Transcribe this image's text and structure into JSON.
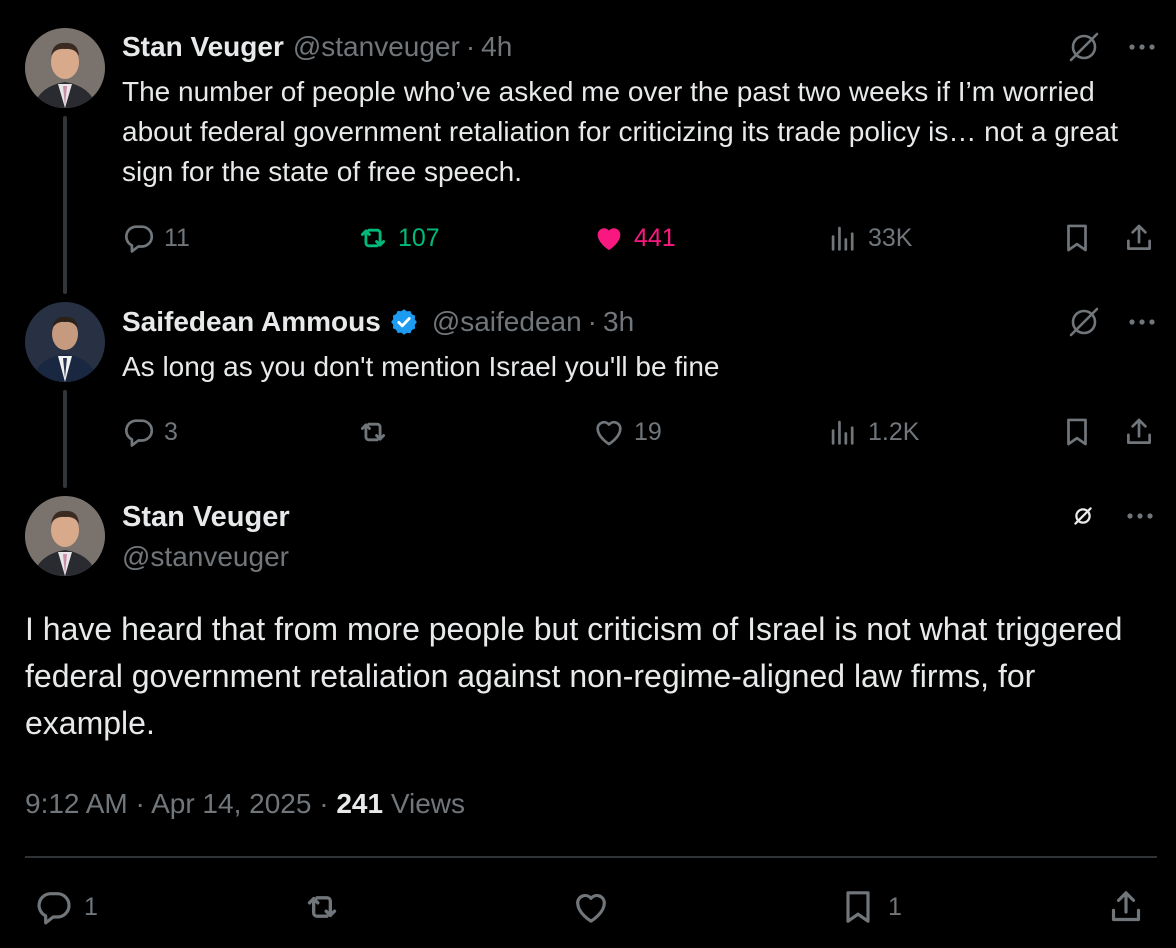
{
  "tweets": [
    {
      "name": "Stan Veuger",
      "handle": "@stanveuger",
      "separator": "·",
      "time": "4h",
      "text": "The number of people who’ve asked me over the past two weeks if I’m worried about federal government retaliation for criticizing its trade policy is… not a great sign for the state of free speech.",
      "replies": "11",
      "reposts": "107",
      "likes": "441",
      "views": "33K",
      "reposted": true,
      "liked": true
    },
    {
      "name": "Saifedean Ammous",
      "verified": true,
      "handle": "@saifedean",
      "separator": "·",
      "time": "3h",
      "text": "As long as you don't mention Israel you'll be fine",
      "replies": "3",
      "reposts": "",
      "likes": "19",
      "views": "1.2K"
    }
  ],
  "main_tweet": {
    "name": "Stan Veuger",
    "handle": "@stanveuger",
    "text": "I have heard that from more people but criticism of Israel is not what triggered federal government retaliation against non-regime-aligned law firms, for example.",
    "time": "9:12 AM",
    "date": "Apr 14, 2025",
    "separator": "·",
    "views_count": "241",
    "views_label": "Views",
    "replies": "1",
    "reposts": "",
    "likes": "",
    "bookmarks": "1"
  },
  "colors": {
    "background": "#000000",
    "text": "#e7e9ea",
    "muted": "#71767b",
    "repost_active": "#00ba7c",
    "like_active": "#f91880",
    "verified": "#1d9bf0",
    "thread_line": "#333639"
  },
  "icons": [
    "reply-icon",
    "repost-icon",
    "like-icon",
    "views-icon",
    "bookmark-icon",
    "share-icon",
    "grok-icon",
    "more-icon",
    "verified-badge-icon"
  ]
}
